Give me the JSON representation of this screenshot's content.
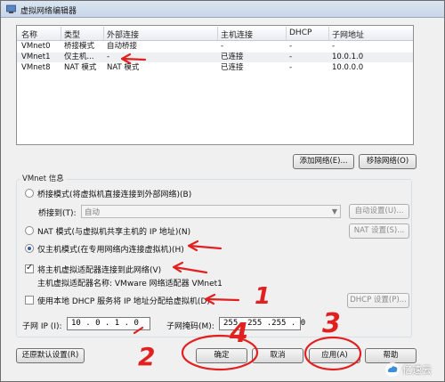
{
  "window": {
    "title": "虚拟网络编辑器"
  },
  "table": {
    "headers": [
      "名称",
      "类型",
      "外部连接",
      "主机连接",
      "DHCP",
      "子网地址"
    ],
    "rows": [
      [
        "VMnet0",
        "桥接模式",
        "自动桥接",
        "-",
        "-",
        "-"
      ],
      [
        "VMnet1",
        "仅主机...",
        "-",
        "已连接",
        "-",
        "10.0.1.0"
      ],
      [
        "VMnet8",
        "NAT 模式",
        "NAT 模式",
        "已连接",
        "-",
        "10.0.0.0"
      ]
    ]
  },
  "buttons": {
    "add_network": "添加网络(E)...",
    "remove_network": "移除网络(O)",
    "auto_settings": "自动设置(U)...",
    "nat_settings": "NAT 设置(S)...",
    "dhcp_settings": "DHCP 设置(P)...",
    "restore_defaults": "还原默认设置(R)",
    "ok": "确定",
    "cancel": "取消",
    "apply": "应用(A)",
    "help": "帮助"
  },
  "vmnet_info": {
    "group_label": "VMnet 信息",
    "bridge_mode": "桥接模式(将虚拟机直接连接到外部网络)(B)",
    "bridge_to_label": "桥接到(T):",
    "bridge_to_value": "自动",
    "nat_mode": "NAT 模式(与虚拟机共享主机的 IP 地址)(N)",
    "host_only_mode": "仅主机模式(在专用网络内连接虚拟机)(H)",
    "connect_adapter": "将主机虚拟适配器连接到此网络(V)",
    "adapter_name": "主机虚拟适配器名称: VMware 网络适配器 VMnet1",
    "use_dhcp": "使用本地 DHCP 服务将 IP 地址分配给虚拟机(D)",
    "subnet_ip_label": "子网 IP (I):",
    "subnet_ip_value": "10 . 0 . 1 . 0",
    "subnet_mask_label": "子网掩码(M):",
    "subnet_mask_value": "255 .255 .255 . 0"
  },
  "annotations": [
    "1",
    "2",
    "3",
    "4"
  ],
  "watermark": {
    "text": "亿速云"
  },
  "colors": {
    "annotation": "#e12020",
    "selection": "#eef0f2",
    "accent": "#2d5bb0"
  }
}
